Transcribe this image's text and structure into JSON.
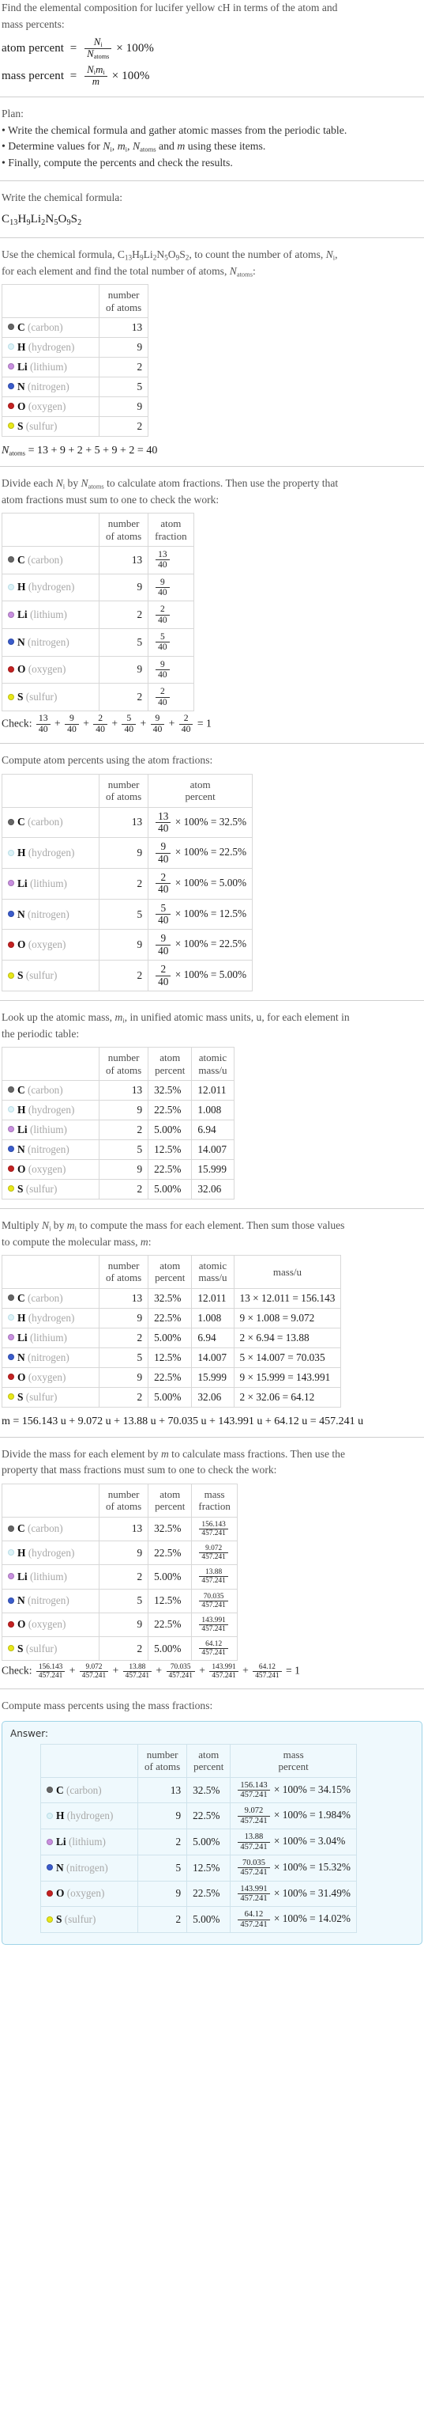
{
  "intro": {
    "question_line1": "Find the elemental composition for lucifer yellow cH in terms of the atom and",
    "question_line2": "mass percents:",
    "atom_percent_label": "atom percent",
    "mass_percent_label": "mass percent",
    "equals": "=",
    "times100": "× 100%",
    "atom_percent_num": "N",
    "atom_percent_num_sub": "i",
    "atom_percent_den": "N",
    "atom_percent_den_sub": "atoms",
    "mass_percent_num": "N",
    "mass_percent_num_sub": "i",
    "mass_percent_num2": "m",
    "mass_percent_num2_sub": "i",
    "mass_percent_den": "m"
  },
  "plan": {
    "heading": "Plan:",
    "items": [
      "Write the chemical formula and gather atomic masses from the periodic table.",
      "Determine values for Nᵢ, mᵢ, Nₐₜₒₘₛ and m using these items.",
      "Finally, compute the percents and check the results."
    ],
    "bullet": "•"
  },
  "formula_section": {
    "heading": "Write the chemical formula:",
    "formula_parts": [
      {
        "sym": "C",
        "sub": "13"
      },
      {
        "sym": "H",
        "sub": "9"
      },
      {
        "sym": "Li",
        "sub": "2"
      },
      {
        "sym": "N",
        "sub": "5"
      },
      {
        "sym": "O",
        "sub": "9"
      },
      {
        "sym": "S",
        "sub": "2"
      }
    ],
    "formula_plain": "C13H9Li2N5O9S2"
  },
  "count_section": {
    "text_line1_a": "Use the chemical formula, ",
    "text_line1_b": ", to count the number of atoms, ",
    "text_line1_c": ",",
    "text_line2_a": "for each element and find the total number of atoms, ",
    "text_line2_b": ":",
    "headers": [
      "",
      "number of atoms"
    ],
    "header_number_of_atoms_l1": "number",
    "header_number_of_atoms_l2": "of atoms",
    "total_label": "N",
    "total_sub": "atoms",
    "total_expr": "= 13 + 9 + 2 + 5 + 9 + 2 = 40"
  },
  "fraction_section": {
    "text_line1": "Divide each Nᵢ by Nₐₜₒₘₛ to calculate atom fractions. Then use the property that",
    "text_line2": "atom fractions must sum to one to check the work:",
    "header_atom_fraction_l1": "atom",
    "header_atom_fraction_l2": "fraction",
    "check_label": "Check:",
    "check_result": "= 1",
    "plus": "+",
    "denominator": "40"
  },
  "atom_percent_section": {
    "text": "Compute atom percents using the atom fractions:",
    "header_atom_percent_l1": "atom",
    "header_atom_percent_l2": "percent",
    "times100eq": "× 100% ="
  },
  "atomic_mass_section": {
    "text_line1": "Look up the atomic mass, mᵢ, in unified atomic mass units, u, for each element in",
    "text_line2": "the periodic table:",
    "header_atom_percent_l1": "atom",
    "header_atom_percent_l2": "percent",
    "header_atomic_mass_l1": "atomic",
    "header_atomic_mass_l2": "mass/u"
  },
  "mass_section": {
    "text_line1": "Multiply Nᵢ by mᵢ to compute the mass for each element. Then sum those values",
    "text_line2": "to compute the molecular mass, m:",
    "header_mass_u": "mass/u",
    "total_line": "m = 156.143 u + 9.072 u + 13.88 u + 70.035 u + 143.991 u + 64.12 u = 457.241 u"
  },
  "mass_fraction_section": {
    "text_line1": "Divide the mass for each element by m to calculate mass fractions. Then use the",
    "text_line2": "property that mass fractions must sum to one to check the work:",
    "header_mass_fraction_l1": "mass",
    "header_mass_fraction_l2": "fraction",
    "check_label": "Check:",
    "check_result": "= 1",
    "plus": "+",
    "denominator": "457.241"
  },
  "mass_percent_section": {
    "text": "Compute mass percents using the mass fractions:",
    "answer_label": "Answer:",
    "header_mass_percent_l1": "mass",
    "header_mass_percent_l2": "percent",
    "times100eq": "× 100% ="
  },
  "chart_data": {
    "type": "table",
    "title": "Elemental composition of lucifer yellow cH (C13H9Li2N5O9S2)",
    "categories": [
      "C (carbon)",
      "H (hydrogen)",
      "Li (lithium)",
      "N (nitrogen)",
      "O (oxygen)",
      "S (sulfur)"
    ],
    "total_atoms": 40,
    "molecular_mass_u": 457.241,
    "series": [
      {
        "name": "number of atoms",
        "values": [
          13,
          9,
          2,
          5,
          9,
          2
        ]
      },
      {
        "name": "atom percent",
        "values": [
          32.5,
          22.5,
          5.0,
          12.5,
          22.5,
          5.0
        ]
      },
      {
        "name": "atomic mass/u",
        "values": [
          12.011,
          1.008,
          6.94,
          14.007,
          15.999,
          32.06
        ]
      },
      {
        "name": "mass/u",
        "values": [
          156.143,
          9.072,
          13.88,
          70.035,
          143.991,
          64.12
        ]
      },
      {
        "name": "mass percent",
        "values": [
          34.15,
          1.984,
          3.04,
          15.32,
          31.49,
          14.02
        ]
      }
    ]
  },
  "elements": [
    {
      "symbol": "C",
      "name": "(carbon)",
      "color": "#666666",
      "hollow": false,
      "count": "13",
      "atom_fraction_num": "13",
      "atom_fraction_den": "40",
      "atom_percent": "32.5%",
      "atomic_mass": "12.011",
      "mass_expr": "13 × 12.011 = 156.143",
      "mass_num": "156.143",
      "mass_den": "457.241",
      "mass_percent": "34.15%"
    },
    {
      "symbol": "H",
      "name": "(hydrogen)",
      "color": "#dcf2f7",
      "hollow": true,
      "count": "9",
      "atom_fraction_num": "9",
      "atom_fraction_den": "40",
      "atom_percent": "22.5%",
      "atomic_mass": "1.008",
      "mass_expr": "9 × 1.008 = 9.072",
      "mass_num": "9.072",
      "mass_den": "457.241",
      "mass_percent": "1.984%"
    },
    {
      "symbol": "Li",
      "name": "(lithium)",
      "color": "#c98fe0",
      "hollow": false,
      "count": "2",
      "atom_fraction_num": "2",
      "atom_fraction_den": "40",
      "atom_percent": "5.00%",
      "atomic_mass": "6.94",
      "mass_expr": "2 × 6.94 = 13.88",
      "mass_num": "13.88",
      "mass_den": "457.241",
      "mass_percent": "3.04%"
    },
    {
      "symbol": "N",
      "name": "(nitrogen)",
      "color": "#3a5ccc",
      "hollow": false,
      "count": "5",
      "atom_fraction_num": "5",
      "atom_fraction_den": "40",
      "atom_percent": "12.5%",
      "atomic_mass": "14.007",
      "mass_expr": "5 × 14.007 = 70.035",
      "mass_num": "70.035",
      "mass_den": "457.241",
      "mass_percent": "15.32%"
    },
    {
      "symbol": "O",
      "name": "(oxygen)",
      "color": "#c42121",
      "hollow": false,
      "count": "9",
      "atom_fraction_num": "9",
      "atom_fraction_den": "40",
      "atom_percent": "22.5%",
      "atomic_mass": "15.999",
      "mass_expr": "9 × 15.999 = 143.991",
      "mass_num": "143.991",
      "mass_den": "457.241",
      "mass_percent": "31.49%"
    },
    {
      "symbol": "S",
      "name": "(sulfur)",
      "color": "#e8e818",
      "hollow": false,
      "count": "2",
      "atom_fraction_num": "2",
      "atom_fraction_den": "40",
      "atom_percent": "5.00%",
      "atomic_mass": "32.06",
      "mass_expr": "2 × 32.06 = 64.12",
      "mass_num": "64.12",
      "mass_den": "457.241",
      "mass_percent": "14.02%"
    }
  ]
}
